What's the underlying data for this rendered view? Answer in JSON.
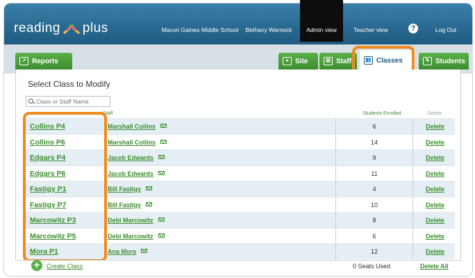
{
  "header": {
    "logo_left": "reading",
    "logo_right": "plus",
    "school": "Macon Gaines Middle School",
    "user": "Bethany Warnock",
    "admin_view": "Admin view",
    "teacher_view": "Teacher view",
    "help": "?",
    "logout": "Log Out"
  },
  "tabs": {
    "reports": "Reports",
    "site": "Site",
    "staff": "Staff",
    "classes": "Classes",
    "students": "Students"
  },
  "panel": {
    "title": "Select Class to Modify",
    "search_placeholder": "Class or Staff Name",
    "col_staff": "Staff",
    "col_enrolled": "Students Enrolled",
    "col_delete": "Delete"
  },
  "rows": [
    {
      "class_name": "Collins P4",
      "staff": "Marshall Collins",
      "enrolled": "6",
      "delete": "Delete"
    },
    {
      "class_name": "Collins P6",
      "staff": "Marshall Collins",
      "enrolled": "14",
      "delete": "Delete"
    },
    {
      "class_name": "Edgars P4",
      "staff": "Jacob Edwards",
      "enrolled": "9",
      "delete": "Delete"
    },
    {
      "class_name": "Edgars P6",
      "staff": "Jacob Edwards",
      "enrolled": "11",
      "delete": "Delete"
    },
    {
      "class_name": "Fastigy P1",
      "staff": "Bill Fastigy",
      "enrolled": "4",
      "delete": "Delete"
    },
    {
      "class_name": "Fastigy P7",
      "staff": "Bill Fastigy",
      "enrolled": "10",
      "delete": "Delete"
    },
    {
      "class_name": "Marcowitz P3",
      "staff": "Debi Marcowitz",
      "enrolled": "8",
      "delete": "Delete"
    },
    {
      "class_name": "Marcowitz P5",
      "staff": "Debi Marcowitz",
      "enrolled": "6",
      "delete": "Delete"
    },
    {
      "class_name": "Mora P1",
      "staff": "Ana Mora",
      "enrolled": "12",
      "delete": "Delete"
    }
  ],
  "footer": {
    "create_class": "Create Class",
    "seats_used": "0 Seats Used",
    "delete_all": "Delete All"
  },
  "colors": {
    "brand_green": "#3d8d2f",
    "header_blue": "#1e5a80",
    "highlight_orange": "#f08a1e"
  }
}
